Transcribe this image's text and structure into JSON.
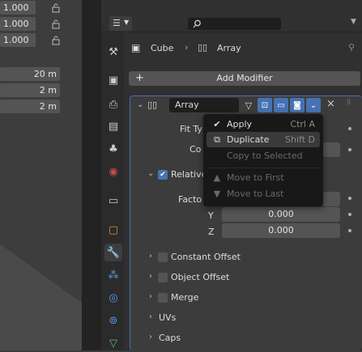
{
  "viewport": {
    "fields_top": [
      "1.000",
      "1.000",
      "1.000"
    ],
    "fields_dims": [
      "20 m",
      "2 m",
      "2 m"
    ]
  },
  "breadcrumb": {
    "object": "Cube",
    "modifier": "Array"
  },
  "add_modifier_label": "Add Modifier",
  "modifier": {
    "name": "Array",
    "fit_type_label": "Fit Ty",
    "count_label": "Co",
    "relative_label": "Relative",
    "factor_label": "Facto",
    "y_label": "Y",
    "y_value": "0.000",
    "z_label": "Z",
    "z_value": "0.000",
    "subpanels": [
      "Constant Offset",
      "Object Offset",
      "Merge",
      "UVs",
      "Caps"
    ]
  },
  "menu": {
    "items": [
      {
        "label": "Apply",
        "shortcut": "Ctrl A",
        "state": "normal"
      },
      {
        "label": "Duplicate",
        "shortcut": "Shift D",
        "state": "highlighted"
      },
      {
        "label": "Copy to Selected",
        "shortcut": "",
        "state": "disabled"
      },
      {
        "label": "Move to First",
        "shortcut": "",
        "state": "disabled"
      },
      {
        "label": "Move to Last",
        "shortcut": "",
        "state": "disabled"
      }
    ]
  },
  "colors": {
    "accent": "#4772b3",
    "panel_bg": "#3c3c3c",
    "menu_bg": "#181818"
  }
}
